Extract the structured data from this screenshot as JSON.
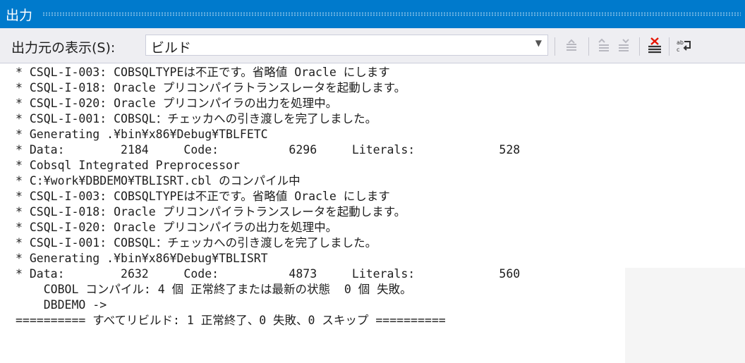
{
  "title": "出力",
  "toolbar": {
    "show_output_label": "出力元の表示(S):",
    "source_value": "ビルド",
    "buttons": [
      {
        "name": "go-to-previous-message",
        "icon": "previous-message-icon",
        "enabled": false
      },
      {
        "name": "find-previous-message",
        "icon": "find-previous-icon",
        "enabled": false
      },
      {
        "name": "find-next-message",
        "icon": "find-next-icon",
        "enabled": false
      },
      {
        "name": "clear-all",
        "icon": "clear-all-icon",
        "enabled": true
      },
      {
        "name": "toggle-word-wrap",
        "icon": "word-wrap-icon",
        "enabled": true
      }
    ]
  },
  "output": {
    "lines": [
      "* CSQL-I-003: COBSQLTYPEは不正です。省略値 Oracle にします",
      "* CSQL-I-018: Oracle プリコンパイラトランスレータを起動します。",
      "* CSQL-I-020: Oracle プリコンパイラの出力を処理中。",
      "* CSQL-I-001: COBSQL：チェッカへの引き渡しを完了しました。",
      "* Generating .¥bin¥x86¥Debug¥TBLFETC",
      "* Data:        2184     Code:          6296     Literals:            528",
      "* Cobsql Integrated Preprocessor",
      "* C:¥work¥DBDEMO¥TBLISRT.cbl のコンパイル中",
      "* CSQL-I-003: COBSQLTYPEは不正です。省略値 Oracle にします",
      "* CSQL-I-018: Oracle プリコンパイラトランスレータを起動します。",
      "* CSQL-I-020: Oracle プリコンパイラの出力を処理中。",
      "* CSQL-I-001: COBSQL：チェッカへの引き渡しを完了しました。",
      "* Generating .¥bin¥x86¥Debug¥TBLISRT",
      "* Data:        2632     Code:          4873     Literals:            560",
      "    COBOL コンパイル: 4 個 正常終了または最新の状態  0 個 失敗。",
      "    DBDEMO ->",
      "========== すべてリビルド: 1 正常終了、0 失敗、0 スキップ =========="
    ]
  },
  "colors": {
    "title_bar": "#007acc",
    "toolbar_bg": "#eeeef2",
    "clear_icon_red": "#e51400"
  }
}
